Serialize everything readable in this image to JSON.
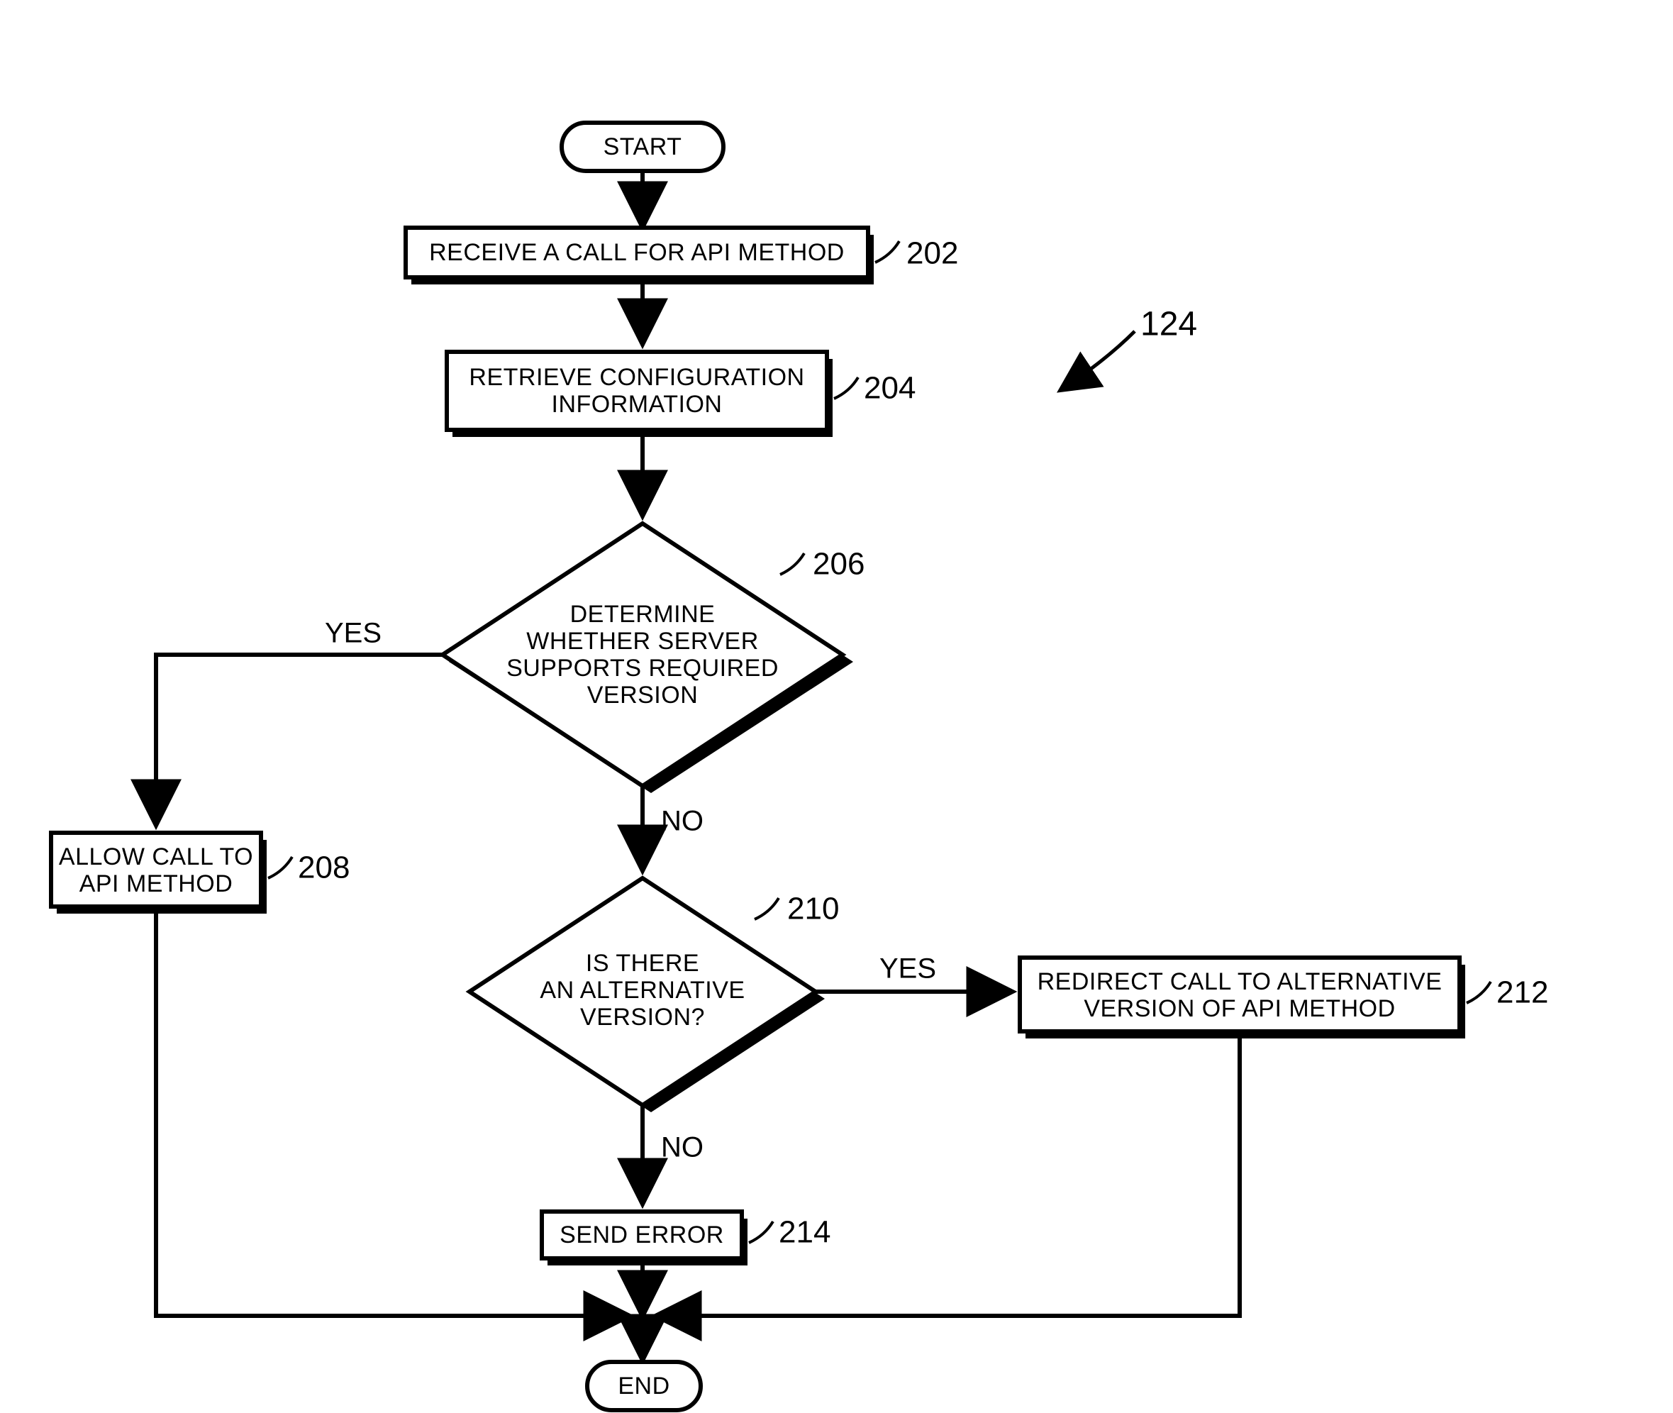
{
  "figure_ref": "124",
  "nodes": {
    "start": "START",
    "end": "END",
    "step202": {
      "text": "RECEIVE A CALL FOR API METHOD",
      "ref": "202"
    },
    "step204": {
      "text": [
        "RETRIEVE CONFIGURATION",
        "INFORMATION"
      ],
      "ref": "204"
    },
    "dec206": {
      "text": [
        "DETERMINE",
        "WHETHER SERVER",
        "SUPPORTS REQUIRED",
        "VERSION"
      ],
      "ref": "206"
    },
    "step208": {
      "text": [
        "ALLOW CALL TO",
        "API METHOD"
      ],
      "ref": "208"
    },
    "dec210": {
      "text": [
        "IS THERE",
        "AN ALTERNATIVE",
        "VERSION?"
      ],
      "ref": "210"
    },
    "step212": {
      "text": [
        "REDIRECT CALL TO ALTERNATIVE",
        "VERSION OF API METHOD"
      ],
      "ref": "212"
    },
    "step214": {
      "text": "SEND ERROR",
      "ref": "214"
    }
  },
  "edge_labels": {
    "yes": "YES",
    "no": "NO"
  }
}
